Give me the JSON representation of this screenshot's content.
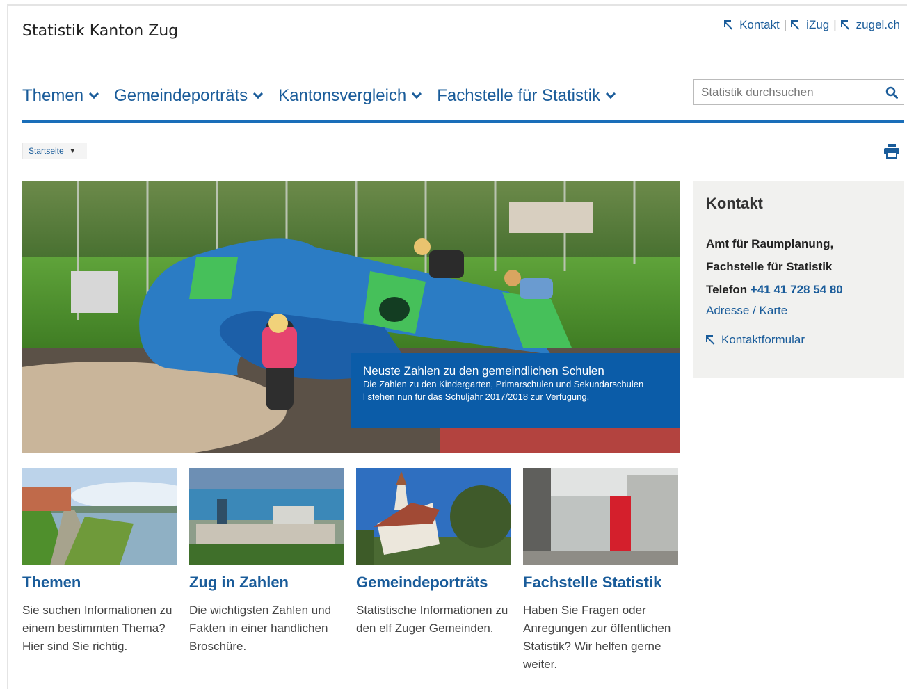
{
  "header": {
    "site_title": "Statistik Kanton Zug",
    "links": [
      {
        "label": "Kontakt"
      },
      {
        "label": "iZug"
      },
      {
        "label": "zugel.ch"
      }
    ]
  },
  "nav": {
    "items": [
      {
        "label": "Themen"
      },
      {
        "label": "Gemeindeporträts"
      },
      {
        "label": "Kantonsvergleich"
      },
      {
        "label": "Fachstelle für Statistik"
      }
    ],
    "search_placeholder": "Statistik durchsuchen"
  },
  "breadcrumb": {
    "label": "Startseite"
  },
  "hero": {
    "headline": "Neuste Zahlen zu den gemeindlichen Schulen",
    "text": "Die Zahlen zu den Kindergarten, Primarschulen und Sekundarschulen",
    "text2": "l stehen nun für das Schuljahr 2017/2018 zur Verfügung."
  },
  "contact": {
    "title": "Kontakt",
    "org_line1": "Amt für Raumplanung,",
    "org_line2": "Fachstelle für Statistik",
    "phone_label": "Telefon",
    "phone_number": "+41 41 728 54 80",
    "address_link": "Adresse / Karte",
    "form_link": "Kontaktformular"
  },
  "tiles": [
    {
      "title": "Themen",
      "desc": [
        "Sie suchen Informationen zu",
        "einem bestimmten Thema?",
        "Hier sind Sie richtig."
      ]
    },
    {
      "title": "Zug in Zahlen",
      "desc": [
        "Die wichtigsten Zahlen und",
        "Fakten in einer handlichen",
        "Broschüre."
      ]
    },
    {
      "title": "Gemeindeporträts",
      "desc": [
        "Statistische Informationen zu",
        "den elf Zuger Gemeinden."
      ]
    },
    {
      "title": "Fachstelle Statistik",
      "desc": [
        "Haben Sie Fragen oder",
        "Anregungen zur öffentlichen",
        "Statistik? Wir helfen gerne",
        "weiter."
      ]
    }
  ],
  "colors": {
    "brand_blue": "#1a5c9a",
    "caption_blue": "#0b5ca8",
    "nav_rule": "#1a6eb9"
  }
}
